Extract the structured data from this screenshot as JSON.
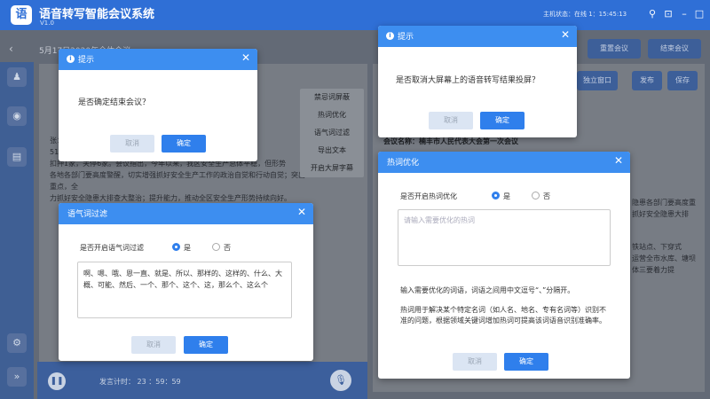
{
  "app": {
    "logo_char": "语",
    "title": "语音转写智能会议系统",
    "version": "V1.0",
    "host_status": "主机状态：在线  1：15:45:13"
  },
  "meeting": {
    "title": "5月17日2020年全体会议",
    "buttons": {
      "restart": "重置会议",
      "end": "结束会议",
      "standalone": "独立窗口",
      "publish": "发布",
      "save": "保存"
    },
    "name_line": "会议名称：楠丰市人民代表大会第一次会议",
    "left_text": [
      "张：截止6月3日",
      "51                                   26家，局部",
      "扣押1家，关停6家。会议指出，今年以来，我区安全生产总体平稳，但形势",
      "各地各部门要高度警醒，切实增强抓好安全生产工作的政治自觉和行动自觉；突出重点，全",
      "力抓好安全隐患大排查大整治；提升能力，推动全区安全生产形势持续向好。"
    ],
    "right_text": [
      "隐患各部门要高度重",
      "抓好安全隐患大排",
      "铁站点、下穿式",
      "运营全市水库、塘坝",
      "体三要着力提"
    ],
    "timer": "发言计时：  23 ：59：59"
  },
  "context_menu": [
    "禁忌词屏蔽",
    "热词优化",
    "语气词过滤",
    "导出文本",
    "开启大屏字幕"
  ],
  "dialog_end": {
    "title": "提示",
    "message": "是否确定结束会议？",
    "cancel": "取消",
    "confirm": "确定"
  },
  "dialog_screen": {
    "title": "提示",
    "message": "是否取消大屏幕上的语音转写结果投屏？",
    "cancel": "取消",
    "confirm": "确定"
  },
  "dialog_filler": {
    "title": "语气词过滤",
    "question": "是否开启语气词过滤",
    "yes": "是",
    "no": "否",
    "words": "啊、嗯、哦、恩一直、就是、所以、那样的、这样的、什么、大概、可能、然后、一个、那个、这个、这，那么个、这么个",
    "cancel": "取消",
    "confirm": "确定"
  },
  "dialog_hotword": {
    "title": "热词优化",
    "question": "是否开启热词优化",
    "yes": "是",
    "no": "否",
    "placeholder": "请输入需要优化的热词",
    "hint": "输入需要优化的词语，词语之间用中文逗号“、”分隔开。",
    "desc": "热词用于解决某个特定名词（如人名、地名、专有名词等）识别不准的问题，根据领域关键词增加热词可提高该词语音识别准确率。",
    "cancel": "取消",
    "confirm": "确定"
  },
  "colors": {
    "accent": "#2f7fec",
    "header": "#3d8ef0",
    "titlebar": "#2f6fd6"
  },
  "icons": [
    "user-icon",
    "eye-icon",
    "document-icon",
    "gear-icon",
    "expand-icon",
    "pause-icon",
    "mic-icon",
    "close-icon",
    "info-icon",
    "pin-icon",
    "lock-icon",
    "minimize-icon",
    "maximize-icon"
  ]
}
